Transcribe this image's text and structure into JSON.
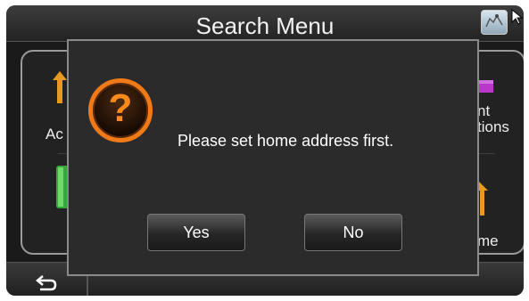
{
  "header": {
    "title": "Search Menu",
    "map_icon": "map-icon"
  },
  "menu": {
    "items": [
      {
        "label": "Ac",
        "icon": "arrow-up-icon",
        "color": "#f0a020"
      },
      {
        "label": "nt\ntions",
        "icon": "flag-icon",
        "color": "#c040d0"
      },
      {
        "label": "",
        "icon": "green-block-icon",
        "color": "#40b040"
      },
      {
        "label": "me",
        "icon": "home-arrow-icon",
        "color": "#f0a020"
      }
    ]
  },
  "dialog": {
    "icon": "question-icon",
    "message": "Please set home address first.",
    "yes_label": "Yes",
    "no_label": "No",
    "accent_color": "#f07a17"
  },
  "footer": {
    "back_icon": "back-arrow-icon"
  }
}
